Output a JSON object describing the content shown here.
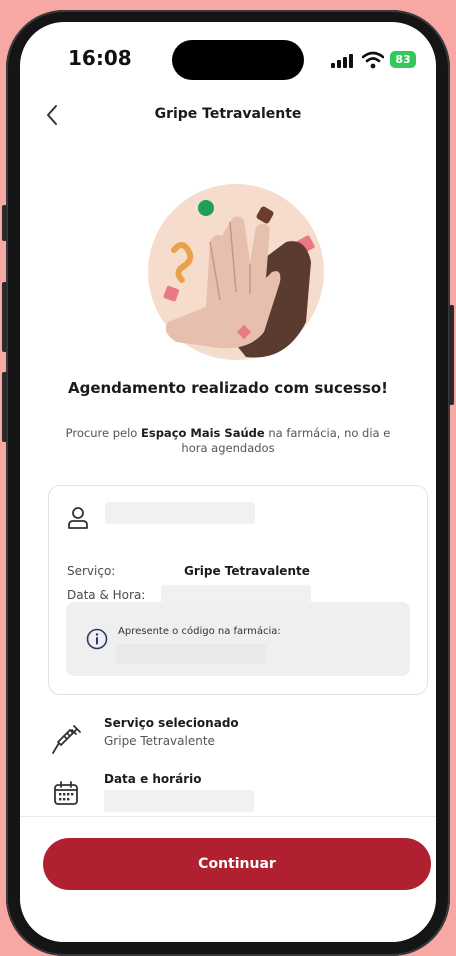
{
  "status_bar": {
    "time": "16:08",
    "battery": "83"
  },
  "header": {
    "title": "Gripe Tetravalente",
    "back_icon": "chevron-left-icon"
  },
  "success": {
    "title": "Agendamento realizado com sucesso!",
    "desc_prefix": "Procure pelo ",
    "desc_bold": "Espaço Mais Saúde",
    "desc_suffix": " na farmácia, no dia e hora agendados"
  },
  "card": {
    "service_label": "Serviço:",
    "service_value": "Gripe Tetravalente",
    "datetime_label": "Data & Hora:",
    "code_label": "Apresente o código na farmácia:"
  },
  "summary": {
    "service_title": "Serviço selecionado",
    "service_value": "Gripe Tetravalente",
    "datetime_title": "Data e horário"
  },
  "footer": {
    "continue_label": "Continuar"
  },
  "colors": {
    "primary": "#b02030",
    "background": "#f7a7a4",
    "battery": "#34c759"
  }
}
